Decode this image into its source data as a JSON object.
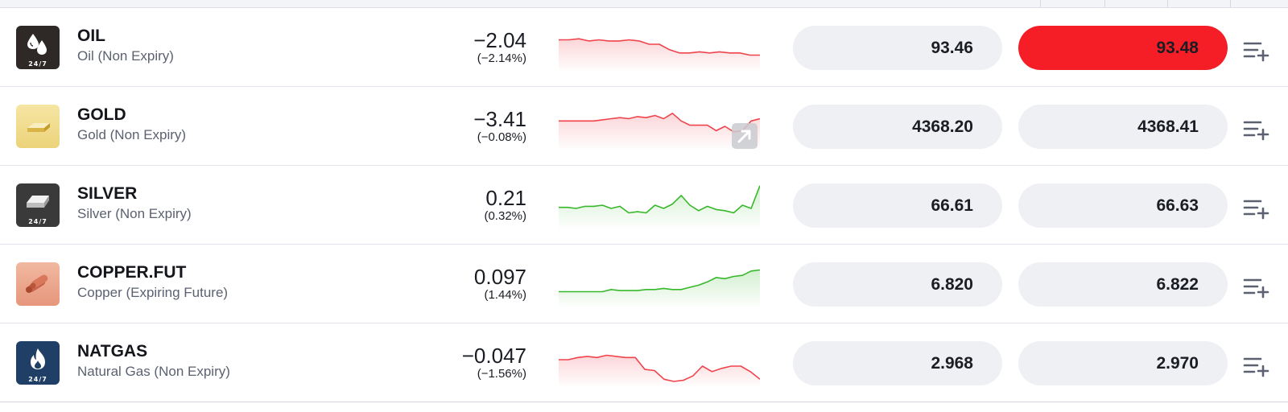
{
  "colors": {
    "down": "#f0444d",
    "up": "#37b82a",
    "ask_active": "#f61e26",
    "pill": "#eff0f4"
  },
  "instruments": [
    {
      "id": "oil",
      "symbol": "OIL",
      "description": "Oil (Non Expiry)",
      "change": "−2.04",
      "change_pct": "(−2.14%)",
      "trend": "down",
      "bid": "93.46",
      "ask": "93.48",
      "ask_highlighted": true,
      "badge": "24/7",
      "icon": "oil-drops-icon",
      "sparkline": [
        42,
        42,
        43,
        41,
        42,
        41,
        41,
        42,
        41,
        38,
        38,
        33,
        30,
        30,
        31,
        30,
        31,
        30,
        30,
        28,
        28
      ]
    },
    {
      "id": "gold",
      "symbol": "GOLD",
      "description": "Gold (Non Expiry)",
      "change": "−3.41",
      "change_pct": "(−0.08%)",
      "trend": "down",
      "bid": "4368.20",
      "ask": "4368.41",
      "ask_highlighted": false,
      "badge": "",
      "icon": "gold-bar-icon",
      "sparkline": [
        40,
        40,
        40,
        40,
        40,
        41,
        42,
        43,
        42,
        44,
        43,
        45,
        42,
        47,
        40,
        36,
        36,
        36,
        31,
        35,
        30,
        31,
        40,
        42
      ]
    },
    {
      "id": "silver",
      "symbol": "SILVER",
      "description": "Silver (Non Expiry)",
      "change": "0.21",
      "change_pct": "(0.32%)",
      "trend": "up",
      "bid": "66.61",
      "ask": "66.63",
      "ask_highlighted": false,
      "badge": "24/7",
      "icon": "silver-bar-icon",
      "sparkline": [
        33,
        33,
        32,
        34,
        34,
        35,
        32,
        34,
        28,
        29,
        28,
        35,
        32,
        36,
        44,
        35,
        30,
        34,
        31,
        30,
        28,
        35,
        32,
        53
      ]
    },
    {
      "id": "copper",
      "symbol": "COPPER.FUT",
      "description": "Copper (Expiring Future)",
      "change": "0.097",
      "change_pct": "(1.44%)",
      "trend": "up",
      "bid": "6.820",
      "ask": "6.822",
      "ask_highlighted": false,
      "badge": "",
      "icon": "copper-pipes-icon",
      "sparkline": [
        28,
        28,
        28,
        28,
        28,
        28,
        30,
        29,
        29,
        29,
        30,
        30,
        31,
        30,
        30,
        32,
        34,
        37,
        41,
        40,
        42,
        43,
        47,
        48
      ]
    },
    {
      "id": "natgas",
      "symbol": "NATGAS",
      "description": "Natural Gas (Non Expiry)",
      "change": "−0.047",
      "change_pct": "(−1.56%)",
      "trend": "down",
      "bid": "2.968",
      "ask": "2.970",
      "ask_highlighted": false,
      "badge": "24/7",
      "icon": "flame-icon",
      "sparkline": [
        38,
        38,
        40,
        41,
        40,
        42,
        41,
        40,
        40,
        29,
        28,
        20,
        18,
        19,
        23,
        32,
        27,
        30,
        32,
        32,
        27,
        20
      ]
    }
  ]
}
